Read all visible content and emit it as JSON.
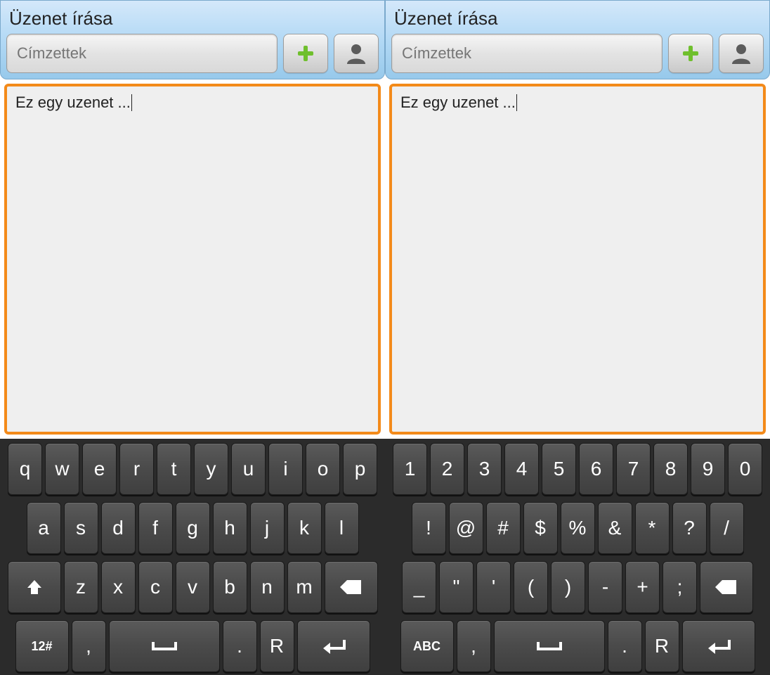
{
  "header": {
    "title": "Üzenet írása",
    "recipients_placeholder": "Címzettek"
  },
  "message": {
    "text": "Ez egy uzenet ..."
  },
  "keyboard_left": {
    "row1": [
      "q",
      "w",
      "e",
      "r",
      "t",
      "y",
      "u",
      "i",
      "o",
      "p"
    ],
    "row2": [
      "a",
      "s",
      "d",
      "f",
      "g",
      "h",
      "j",
      "k",
      "l"
    ],
    "row3": [
      "z",
      "x",
      "c",
      "v",
      "b",
      "n",
      "m"
    ],
    "mode_key": "12#",
    "comma": ",",
    "period": ".",
    "return": "R"
  },
  "keyboard_right": {
    "row1": [
      "1",
      "2",
      "3",
      "4",
      "5",
      "6",
      "7",
      "8",
      "9",
      "0"
    ],
    "row2": [
      "!",
      "@",
      "#",
      "$",
      "%",
      "&",
      "*",
      "?",
      "/"
    ],
    "row3": [
      "_",
      "\"",
      "'",
      "(",
      ")",
      "-",
      "+",
      ";"
    ],
    "mode_key": "ABC",
    "comma": ",",
    "period": ".",
    "return": "R"
  }
}
